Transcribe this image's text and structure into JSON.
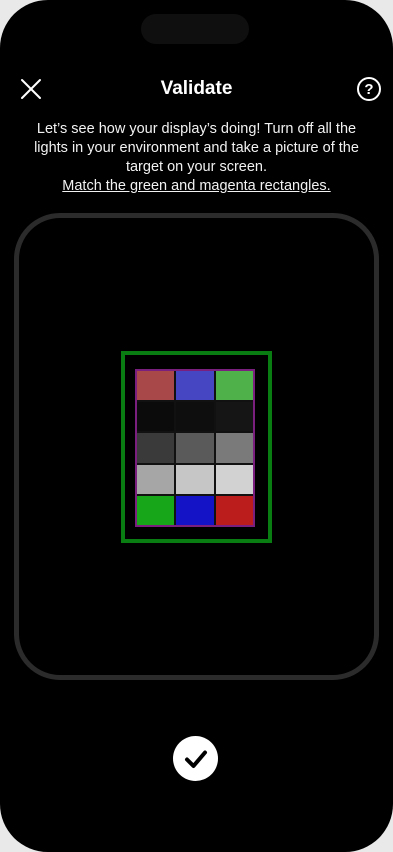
{
  "header": {
    "title": "Validate",
    "close_icon": "close-icon",
    "help_label": "?",
    "help_icon": "help-icon"
  },
  "instructions": {
    "text": "Let’s see how your display’s doing! Turn off all the lights in your environment and take a picture of the target on your screen.",
    "link": "Match the green and magenta rectangles."
  },
  "target": {
    "outer_color": "#0a7d12",
    "inner_color": "#7a1f7e",
    "swatches": [
      [
        "#a84848",
        "#4646c2",
        "#4fb14a"
      ],
      [
        "#0b0b0b",
        "#0e0e0e",
        "#151515"
      ],
      [
        "#3a3a3a",
        "#5a5a5a",
        "#7a7a7a"
      ],
      [
        "#a6a6a6",
        "#c6c6c6",
        "#d2d2d2"
      ],
      [
        "#17a51a",
        "#1414c6",
        "#bb1d1d"
      ]
    ]
  },
  "footer": {
    "confirm_icon": "checkmark-icon"
  }
}
